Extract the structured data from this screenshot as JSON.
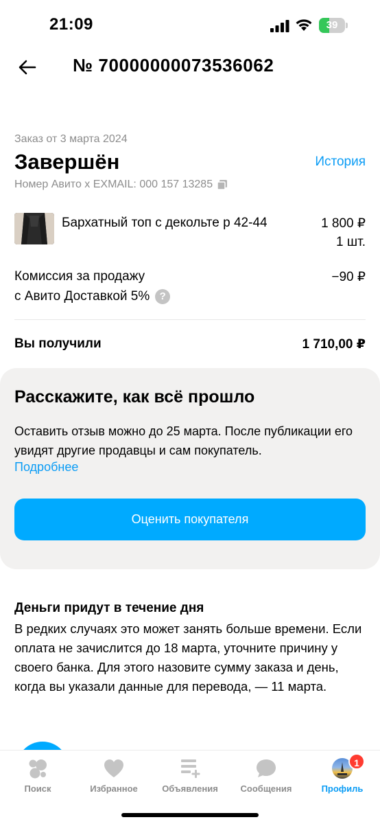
{
  "status_bar": {
    "time": "21:09",
    "battery": "39",
    "battery_level": 0.39
  },
  "header": {
    "order_title": "№ 70000000073536062"
  },
  "order": {
    "date": "Заказ от 3 марта 2024",
    "status": "Завершён",
    "history_link": "История",
    "avito_number": "Номер Авито х EXMAIL: 000 157 13285"
  },
  "item": {
    "name": "Бархатный топ с декольте р 42-44",
    "price": "1 800 ₽",
    "qty": "1 шт."
  },
  "fee": {
    "line1": "Комиссия за продажу",
    "line2": "с Авито Доставкой 5%",
    "amount": "−90 ₽",
    "help_icon": "?"
  },
  "total": {
    "label": "Вы получили",
    "amount": "1 710,00 ₽"
  },
  "review": {
    "title": "Расскажите, как всё прошло",
    "text": "Оставить отзыв можно до 25 марта. После публикации его увидят другие продавцы и сам покупатель.",
    "more_link": "Подробнее",
    "button_label": "Оценить покупателя"
  },
  "money": {
    "title": "Деньги придут в течение дня",
    "text": "В редких случаях это может занять больше времени. Если оплата не зачислится до 18 марта, уточните причину у своего банка. Для этого назовите сумму заказа и день, когда вы указали данные для перевода, — 11 марта."
  },
  "tab_bar": {
    "tabs": [
      {
        "label": "Поиск",
        "icon": "search-dots-icon"
      },
      {
        "label": "Избранное",
        "icon": "heart-icon"
      },
      {
        "label": "Объявления",
        "icon": "listings-icon"
      },
      {
        "label": "Сообщения",
        "icon": "chat-icon"
      },
      {
        "label": "Профиль",
        "icon": "avatar"
      }
    ],
    "active_tab": "Профиль",
    "profile_badge": "1"
  },
  "colors": {
    "accent": "#0a9cf5",
    "button": "#00aaff",
    "badge": "#ff3b30",
    "battery": "#34c759"
  }
}
